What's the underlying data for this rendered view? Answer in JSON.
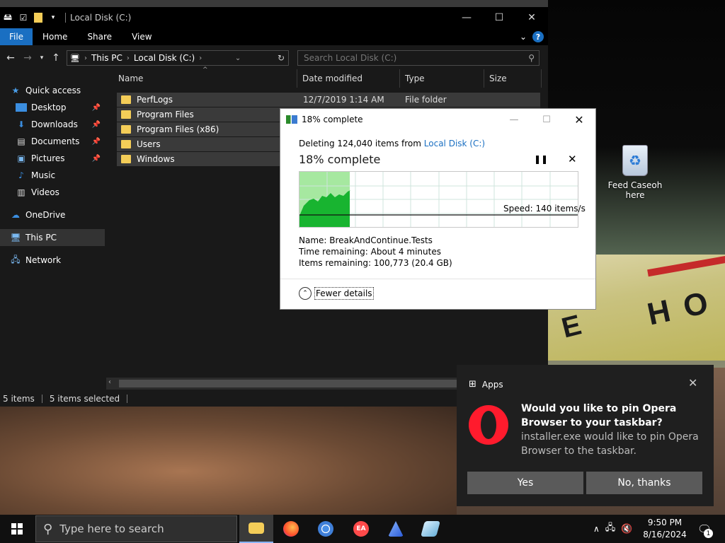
{
  "explorer": {
    "title": "Local Disk (C:)",
    "ribbon": {
      "file": "File",
      "home": "Home",
      "share": "Share",
      "view": "View",
      "help": "?"
    },
    "address": {
      "this_pc": "This PC",
      "local_disk": "Local Disk (C:)"
    },
    "search_placeholder": "Search Local Disk (C:)",
    "sidebar": [
      {
        "label": "Quick access",
        "icon": "star-icon"
      },
      {
        "label": "Desktop",
        "icon": "desktop-icon"
      },
      {
        "label": "Downloads",
        "icon": "download-icon"
      },
      {
        "label": "Documents",
        "icon": "document-icon"
      },
      {
        "label": "Pictures",
        "icon": "picture-icon"
      },
      {
        "label": "Music",
        "icon": "music-icon"
      },
      {
        "label": "Videos",
        "icon": "video-icon"
      },
      {
        "label": "OneDrive",
        "icon": "cloud-icon"
      },
      {
        "label": "This PC",
        "icon": "computer-icon"
      },
      {
        "label": "Network",
        "icon": "network-icon"
      }
    ],
    "columns": {
      "name": "Name",
      "date": "Date modified",
      "type": "Type",
      "size": "Size"
    },
    "rows": [
      {
        "name": "PerfLogs",
        "date": "12/7/2019 1:14 AM",
        "type": "File folder"
      },
      {
        "name": "Program Files"
      },
      {
        "name": "Program Files (x86)"
      },
      {
        "name": "Users"
      },
      {
        "name": "Windows"
      }
    ],
    "status": {
      "items": "5 items",
      "selected": "5 items selected"
    }
  },
  "dialog": {
    "title": "18% complete",
    "line_prefix": "Deleting 124,040 items from ",
    "line_link": "Local Disk (C:)",
    "big": "18% complete",
    "progress_fraction": 0.18,
    "speed": "Speed: 140 items/s",
    "name": "Name:  BreakAndContinue.Tests",
    "time": "Time remaining:  About 4 minutes",
    "items_remaining": "Items remaining:  100,773 (20.4 GB)",
    "fewer": "Fewer details"
  },
  "desktop": {
    "recycle_label_1": "Feed Caseoh",
    "recycle_label_2": "here"
  },
  "toast": {
    "app": "Apps",
    "title": "Would you like to pin Opera Browser to your taskbar?",
    "body": "installer.exe would like to pin Opera Browser to the taskbar.",
    "yes": "Yes",
    "no": "No, thanks"
  },
  "taskbar": {
    "search_placeholder": "Type here to search",
    "time": "9:50 PM",
    "date": "8/16/2024",
    "notification_count": "1"
  },
  "bg_sign": {
    "left_text": "E",
    "right_text": "HO"
  }
}
